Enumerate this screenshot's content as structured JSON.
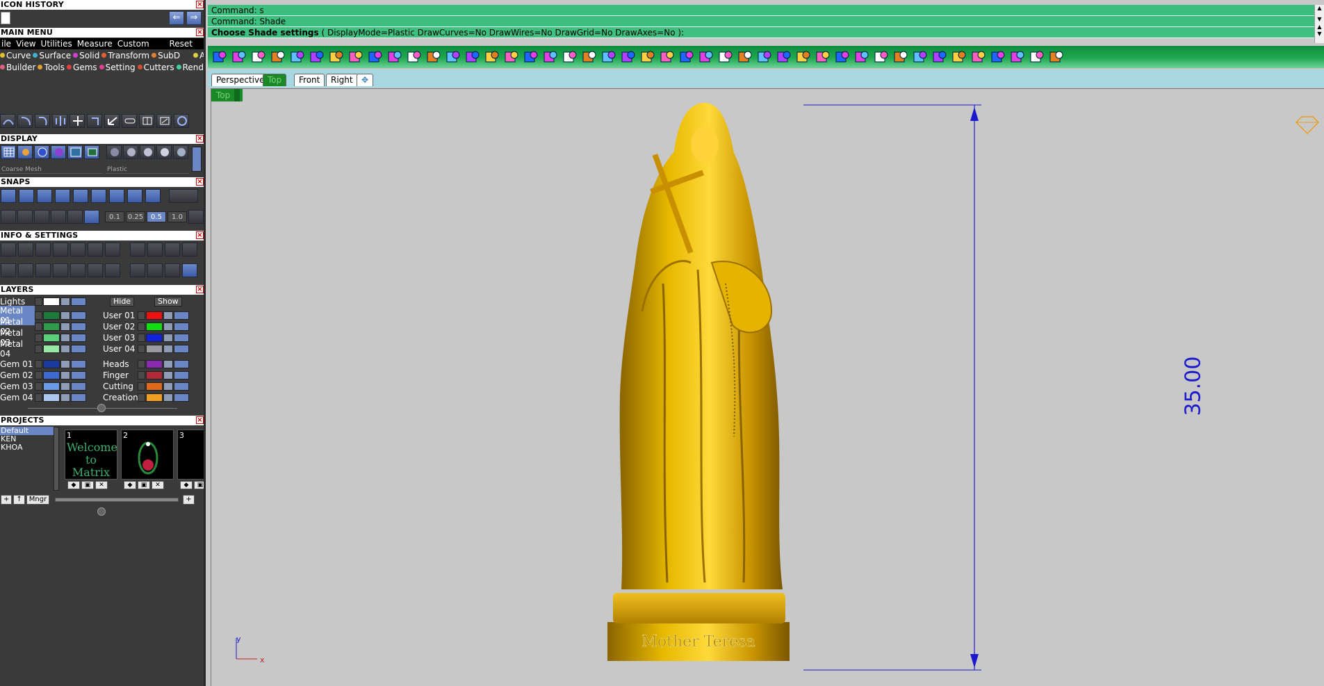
{
  "left": {
    "icon_history": {
      "title": "ICON HISTORY"
    },
    "main_menu": {
      "title": "MAIN MENU",
      "menus": [
        "ile",
        "View",
        "Utilities",
        "Measure",
        "Custom"
      ],
      "reset": "Reset",
      "row1": [
        {
          "label": "Curve",
          "color": "#e0c030"
        },
        {
          "label": "Surface",
          "color": "#40b0d0"
        },
        {
          "label": "Solid",
          "color": "#d040d0"
        },
        {
          "label": "Transform",
          "color": "#e06030"
        },
        {
          "label": "SubD",
          "color": "#e08030"
        },
        {
          "label": "Art",
          "color": "#e0d040"
        }
      ],
      "row2": [
        {
          "label": "Builder",
          "color": "#e06080"
        },
        {
          "label": "Tools",
          "color": "#e0a030"
        },
        {
          "label": "Gems",
          "color": "#e04040"
        },
        {
          "label": "Setting",
          "color": "#e04090"
        },
        {
          "label": "Cutters",
          "color": "#d05030"
        },
        {
          "label": "Render",
          "color": "#40d0a0"
        }
      ]
    },
    "display": {
      "title": "DISPLAY",
      "mesh_select": "Coarse Mesh",
      "material_select": "Plastic"
    },
    "snaps": {
      "title": "SNAPS",
      "values": [
        "0.1",
        "0.25",
        "0.5",
        "1.0"
      ],
      "active_index": 2
    },
    "info": {
      "title": "INFO & SETTINGS"
    },
    "layers": {
      "title": "LAYERS",
      "lights_label": "Lights",
      "hide_label": "Hide",
      "show_label": "Show",
      "left_col": [
        {
          "name": "Metal 01",
          "color": "#1e7a3c",
          "selected": true
        },
        {
          "name": "Metal 02",
          "color": "#2e9a4a",
          "selected": false
        },
        {
          "name": "Metal 03",
          "color": "#5ad07a",
          "selected": false
        },
        {
          "name": "Metal 04",
          "color": "#9ae8a8",
          "selected": false
        },
        {
          "name": "Gem 01",
          "color": "#1a3aa0",
          "selected": false
        },
        {
          "name": "Gem 02",
          "color": "#3a6ad0",
          "selected": false
        },
        {
          "name": "Gem 03",
          "color": "#6a9ae8",
          "selected": false
        },
        {
          "name": "Gem 04",
          "color": "#aac8f0",
          "selected": false
        }
      ],
      "right_col": [
        {
          "name": "User 01",
          "color": "#ee1111"
        },
        {
          "name": "User 02",
          "color": "#11dd11"
        },
        {
          "name": "User 03",
          "color": "#1122dd"
        },
        {
          "name": "User 04",
          "color": "#9a9aa0"
        },
        {
          "name": "Heads",
          "color": "#8a2ab0"
        },
        {
          "name": "Finger",
          "color": "#b02a3a"
        },
        {
          "name": "Cutting",
          "color": "#e06a1a"
        },
        {
          "name": "Creation",
          "color": "#f0a020"
        }
      ]
    },
    "projects": {
      "title": "PROJECTS",
      "list": [
        "Default",
        "KEN",
        "KHOA"
      ],
      "thumbs": [
        {
          "num": "1",
          "text": "Welcome to Matrix"
        },
        {
          "num": "2",
          "text": ""
        },
        {
          "num": "3",
          "text": ""
        }
      ],
      "mngr": "Mngr"
    }
  },
  "command": {
    "line1": "Command: s",
    "line2": "Command: Shade",
    "prompt_bold": "Choose Shade settings",
    "prompt_rest": "( DisplayMode=Plastic  DrawCurves=No  DrawWires=No  DrawGrid=No  DrawAxes=No ):"
  },
  "viewport_tabs": [
    "Perspective",
    "Top",
    "Front",
    "Right"
  ],
  "active_tab": "Top",
  "viewport": {
    "label": "Top",
    "dimension": "35.00",
    "axis_y": "y",
    "axis_x": "x",
    "model_base_text": "Mother Teresa"
  },
  "colors": {
    "accent_green": "#3cbe7e",
    "toolbar_green": "#20a850",
    "dim_blue": "#1a1acc",
    "gold": "#d4a800"
  }
}
